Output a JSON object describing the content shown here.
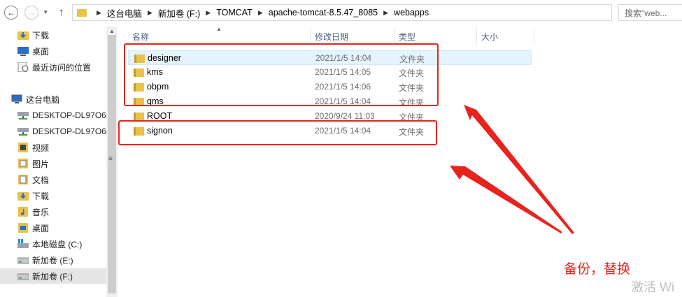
{
  "address_bar": {
    "breadcrumbs": [
      "这台电脑",
      "新加卷 (F:)",
      "TOMCAT",
      "apache-tomcat-8.5.47_8085",
      "webapps"
    ],
    "search_placeholder": "搜索\"web..."
  },
  "nav_pane": {
    "items": [
      {
        "label": "下载",
        "icon": "download-folder-icon"
      },
      {
        "label": "桌面",
        "icon": "desktop-icon"
      },
      {
        "label": "最近访问的位置",
        "icon": "recent-places-icon"
      },
      {
        "label": "这台电脑",
        "icon": "computer-icon"
      },
      {
        "label": "DESKTOP-DL97O6",
        "icon": "network-drive-icon"
      },
      {
        "label": "DESKTOP-DL97O6",
        "icon": "network-drive-icon"
      },
      {
        "label": "视频",
        "icon": "videos-folder-icon"
      },
      {
        "label": "图片",
        "icon": "pictures-folder-icon"
      },
      {
        "label": "文档",
        "icon": "documents-folder-icon"
      },
      {
        "label": "下载",
        "icon": "download-folder-icon"
      },
      {
        "label": "音乐",
        "icon": "music-folder-icon"
      },
      {
        "label": "桌面",
        "icon": "desktop-folder-icon"
      },
      {
        "label": "本地磁盘 (C:)",
        "icon": "local-disk-icon"
      },
      {
        "label": "新加卷 (E:)",
        "icon": "drive-icon"
      },
      {
        "label": "新加卷 (F:)",
        "icon": "drive-icon",
        "selected": true
      }
    ]
  },
  "file_list": {
    "columns": [
      "名称",
      "修改日期",
      "类型",
      "大小"
    ],
    "rows": [
      {
        "name": "designer",
        "date": "2021/1/5 14:04",
        "type": "文件夹",
        "highlighted": true
      },
      {
        "name": "kms",
        "date": "2021/1/5 14:05",
        "type": "文件夹"
      },
      {
        "name": "obpm",
        "date": "2021/1/5 14:06",
        "type": "文件夹"
      },
      {
        "name": "qms",
        "date": "2021/1/5 14:04",
        "type": "文件夹"
      },
      {
        "name": "ROOT",
        "date": "2020/9/24 11:03",
        "type": "文件夹"
      },
      {
        "name": "signon",
        "date": "2021/1/5 14:04",
        "type": "文件夹"
      }
    ]
  },
  "annotation": {
    "text": "备份，替换",
    "color": "#e8231d"
  },
  "watermark": "激活 Wi"
}
